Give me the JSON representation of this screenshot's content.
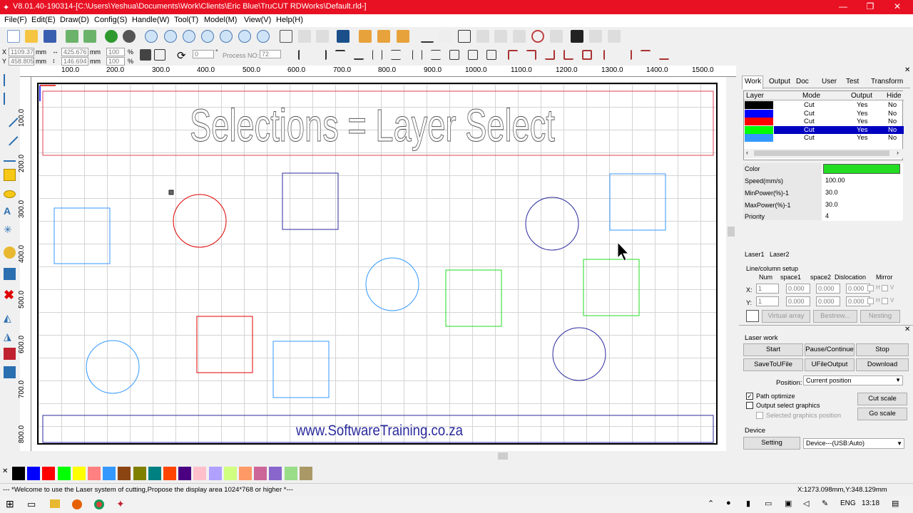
{
  "window": {
    "title": "V8.01.40-190314-[C:\\Users\\Yeshua\\Documents\\Work\\Clients\\Eric Blue\\TruCUT RDWorks\\Default.rld-]"
  },
  "menu": [
    "File(F)",
    "Edit(E)",
    "Draw(D)",
    "Config(S)",
    "Handle(W)",
    "Tool(T)",
    "Model(M)",
    "View(V)",
    "Help(H)"
  ],
  "coords": {
    "x": "1109.37",
    "y": "458.805",
    "unit": "mm",
    "w": "425.676",
    "h": "146.694",
    "sx": "100",
    "sy": "100",
    "pct": "%",
    "angle": "0",
    "deg": "°",
    "process_label": "Process NO:",
    "process_value": "72"
  },
  "ruler_h": [
    "100.0",
    "200.0",
    "300.0",
    "400.0",
    "500.0",
    "600.0",
    "700.0",
    "800.0",
    "900.0",
    "1000.0",
    "1100.0",
    "1200.0",
    "1300.0",
    "1400.0",
    "1500.0"
  ],
  "ruler_v": [
    "100.0",
    "200.0",
    "300.0",
    "400.0",
    "500.0",
    "600.0",
    "700.0",
    "800.0"
  ],
  "canvas": {
    "headline": "Selections = Layer Select",
    "footer": "www.SoftwareTraining.co.za"
  },
  "colors": {
    "black": "#000000",
    "blue": "#0000ff",
    "red": "#ff0000",
    "green": "#00ff00",
    "light_blue": "#3399ff",
    "navy": "#2b2b9e",
    "selected_row": "#0000c0"
  },
  "palette": [
    "#000000",
    "#0000ff",
    "#ff0000",
    "#00ff00",
    "#ffff00",
    "#ff8080",
    "#3399ff",
    "#8b4513",
    "#808000",
    "#008080",
    "#ff4500",
    "#4b0082",
    "#ffc0cb",
    "#b0a0ff",
    "#d0ff80",
    "#ff9966",
    "#cc6699",
    "#8866cc",
    "#99dd88",
    "#aa9966"
  ],
  "panel": {
    "tabs": [
      "Work",
      "Output",
      "Doc",
      "User",
      "Test",
      "Transform"
    ],
    "headers": {
      "layer": "Layer",
      "mode": "Mode",
      "output": "Output",
      "hide": "Hide"
    },
    "rows": [
      {
        "color": "#000000",
        "mode": "Cut",
        "output": "Yes",
        "hide": "No",
        "selected": false
      },
      {
        "color": "#0000ff",
        "mode": "Cut",
        "output": "Yes",
        "hide": "No",
        "selected": false
      },
      {
        "color": "#ff0000",
        "mode": "Cut",
        "output": "Yes",
        "hide": "No",
        "selected": false
      },
      {
        "color": "#00ff00",
        "mode": "Cut",
        "output": "Yes",
        "hide": "No",
        "selected": true
      },
      {
        "color": "#3399ff",
        "mode": "Cut",
        "output": "Yes",
        "hide": "No",
        "selected": false
      }
    ],
    "params": [
      {
        "label": "Color",
        "value": ""
      },
      {
        "label": "Speed(mm/s)",
        "value": "100.00"
      },
      {
        "label": "MinPower(%)-1",
        "value": "30.0"
      },
      {
        "label": "MaxPower(%)-1",
        "value": "30.0"
      },
      {
        "label": "Priority",
        "value": "4"
      }
    ],
    "param_color": "#22dd22",
    "laser_tabs": [
      "Laser1",
      "Laser2"
    ],
    "linecol": {
      "title": "Line/column setup",
      "headers": [
        "Num",
        "space1",
        "space2",
        "Dislocation",
        "Mirror"
      ],
      "x_label": "X:",
      "y_label": "Y:",
      "x": [
        "1",
        "0.000",
        "0.000",
        "0.000"
      ],
      "y": [
        "1",
        "0.000",
        "0.000",
        "0.000"
      ],
      "mirror_h": "H",
      "mirror_v": "V",
      "virtual": "Virtual array",
      "bestrew": "Bestrew...",
      "nesting": "Nesting"
    },
    "laser_work": {
      "title": "Laser work",
      "start": "Start",
      "pause": "Pause/Continue",
      "stop": "Stop",
      "save": "SaveToUFile",
      "ufile": "UFileOutput",
      "download": "Download",
      "position_label": "Position:",
      "position_value": "Current position",
      "path_opt": "Path optimize",
      "output_sel": "Output select graphics",
      "sel_pos": "Selected graphics position",
      "cut_scale": "Cut scale",
      "go_scale": "Go scale"
    },
    "device": {
      "title": "Device",
      "setting": "Setting",
      "value": "Device---(USB:Auto)"
    }
  },
  "status": {
    "message": "--- *Welcome to use the Laser system of cutting,Propose the display area 1024*768 or higher *---",
    "coords": "X:1273.098mm,Y:348.129mm"
  },
  "taskbar": {
    "lang": "ENG",
    "time": "13:18"
  }
}
